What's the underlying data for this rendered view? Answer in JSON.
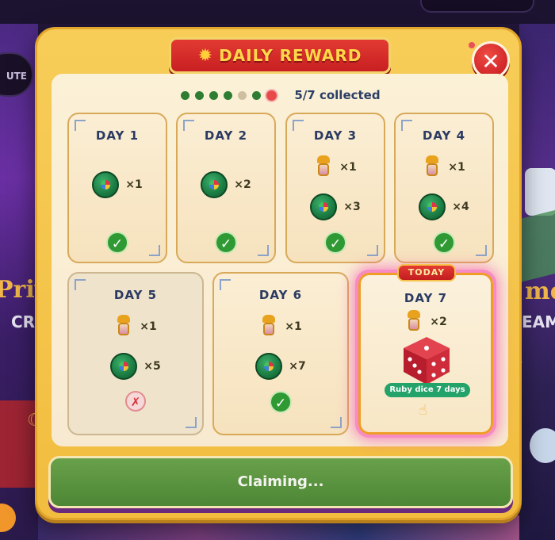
{
  "background": {
    "left_button": "UTE",
    "left_title": "Priv",
    "left_sub": "CR",
    "right_title": "me",
    "right_sub": "EAM"
  },
  "header": {
    "title": "DAILY REWARD",
    "title_icon": "sun-badge-icon",
    "close_icon": "close-icon"
  },
  "progress": {
    "dots": [
      {
        "state": "collected",
        "color": "#2e7d32"
      },
      {
        "state": "collected",
        "color": "#2e7d32"
      },
      {
        "state": "collected",
        "color": "#2e7d32"
      },
      {
        "state": "collected",
        "color": "#2e7d32"
      },
      {
        "state": "missed",
        "color": "#cdbf9f"
      },
      {
        "state": "collected",
        "color": "#2e7d32"
      },
      {
        "state": "current",
        "color": "#e84a4a"
      }
    ],
    "text": "5/7 collected"
  },
  "days": [
    {
      "label": "DAY 1",
      "items": [
        {
          "icon": "green-coin-icon",
          "qty": "×1"
        }
      ],
      "status": "collected",
      "status_glyph": "✓"
    },
    {
      "label": "DAY 2",
      "items": [
        {
          "icon": "green-coin-icon",
          "qty": "×2"
        }
      ],
      "status": "collected",
      "status_glyph": "✓"
    },
    {
      "label": "DAY 3",
      "items": [
        {
          "icon": "lamp-icon",
          "qty": "×1"
        },
        {
          "icon": "green-coin-icon",
          "qty": "×3"
        }
      ],
      "status": "collected",
      "status_glyph": "✓"
    },
    {
      "label": "DAY 4",
      "items": [
        {
          "icon": "lamp-icon",
          "qty": "×1"
        },
        {
          "icon": "green-coin-icon",
          "qty": "×4"
        }
      ],
      "status": "collected",
      "status_glyph": "✓"
    },
    {
      "label": "DAY 5",
      "items": [
        {
          "icon": "lamp-icon",
          "qty": "×1"
        },
        {
          "icon": "green-coin-icon",
          "qty": "×5"
        }
      ],
      "status": "missed",
      "status_glyph": "✗"
    },
    {
      "label": "DAY 6",
      "items": [
        {
          "icon": "lamp-icon",
          "qty": "×1"
        },
        {
          "icon": "green-coin-icon",
          "qty": "×7"
        }
      ],
      "status": "collected",
      "status_glyph": "✓"
    },
    {
      "label": "DAY 7",
      "badge": "TODAY",
      "items": [
        {
          "icon": "lamp-icon",
          "qty": "×2"
        }
      ],
      "bonus": {
        "icon": "ruby-dice-icon",
        "label": "Ruby dice 7 days"
      },
      "status": "today",
      "hand_icon": "pointing-hand-icon"
    }
  ],
  "colors": {
    "panel": "#f2bd3f",
    "title_red": "#d42a27",
    "check_green": "#2f9a34",
    "today_glow": "#f78bc4",
    "claim_green": "#5a9440"
  },
  "claim_button": {
    "label": "Claiming..."
  }
}
